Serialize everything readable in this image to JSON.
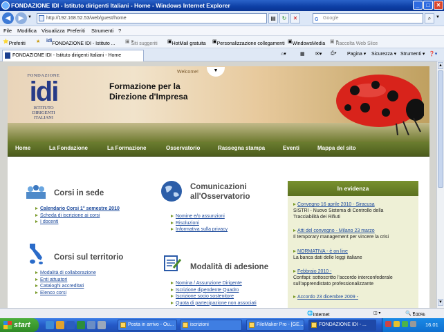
{
  "window": {
    "title": "FONDAZIONE IDI - Istituto dirigenti Italiani - Home - Windows Internet Explorer"
  },
  "address": {
    "url": "http://192.168.52.53/web/guest/home",
    "search_placeholder": "Google"
  },
  "menu": [
    "File",
    "Modifica",
    "Visualizza",
    "Preferiti",
    "Strumenti",
    "?"
  ],
  "favorites": {
    "label": "Preferiti",
    "items": [
      "FONDAZIONE IDI - Istituto ...",
      "Siti suggeriti",
      "HotMail gratuita",
      "Personalizzazione collegamenti",
      "WindowsMedia",
      "Raccolta Web Slice"
    ]
  },
  "tab": {
    "label": "FONDAZIONE IDI - Istituto dirigenti Italiani - Home"
  },
  "toolbar": {
    "page": "Pagina",
    "security": "Sicurezza",
    "tools": "Strumenti"
  },
  "banner": {
    "welcome": "Welcome!",
    "tagline_1": "Formazione per la",
    "tagline_2": "Direzione d'Impresa",
    "logo_top": "FONDAZIONE",
    "logo_idi": "idi",
    "logo_sub_1": "ISTITUTO",
    "logo_sub_2": "DIRIGENTI",
    "logo_sub_3": "ITALIANI"
  },
  "nav": [
    "Home",
    "La Fondazione",
    "La Formazione",
    "Osservatorio",
    "Rassegna stampa",
    "Eventi",
    "Mappa del sito"
  ],
  "sections": {
    "corsi_sede": {
      "title": "Corsi in sede",
      "links": [
        "Calendario Corsi 1° semestre 2010",
        "Scheda di iscrizione ai corsi",
        "I docenti"
      ]
    },
    "corsi_territorio": {
      "title": "Corsi sul territorio",
      "links": [
        "Modalità di collaborazione",
        "Enti attuatori",
        "Cataloghi accreditati",
        "Elenco corsi"
      ]
    },
    "comunicazioni": {
      "title_1": "Comunicazioni",
      "title_2": "all'Osservatorio",
      "links": [
        "Nomine e/o assunzioni",
        "Risoluzioni",
        "Informativa sulla privacy"
      ]
    },
    "adesione": {
      "title": "Modalità di adesione",
      "links": [
        "Nomina / Assunzione Dirigente",
        "Iscrizione dipendente Quadro",
        "Iscrizione socio sostenitore",
        "Quota di partecipazione non associati"
      ]
    }
  },
  "evidenza": {
    "title": "In evidenza",
    "items": [
      {
        "link": "Convegno 16 aprile 2010 - Siracusa",
        "text_1": "SISTRI - Nuovo Sistema di Controllo della",
        "text_2": "Tracciabilità dei Rifiuti"
      },
      {
        "link": "Atti del convegno - Milano 23 marzo",
        "text_1": "Il temporary management per vincere la crisi",
        "text_2": ""
      },
      {
        "link": "NORMATIVA - è on line",
        "text_1": "La banca dati delle leggi italiane",
        "text_2": ""
      },
      {
        "link": "Febbraio 2010 -",
        "text_1": "Confapi: sottoscritto l'accordo interconfederale",
        "text_2": "sull'apprendistato professionalizzante"
      },
      {
        "link": "Accordo 23 dicembre 2009 -",
        "text_1": "",
        "text_2": ""
      }
    ]
  },
  "status": {
    "zone": "Internet",
    "zoom": "100%"
  },
  "taskbar": {
    "start": "start",
    "tasks": [
      "Posta in arrivo - Ou...",
      "iscrizioni",
      "FileMaker Pro - [GE...",
      "FONDAZIONE IDI - ..."
    ],
    "clock": "16.01"
  },
  "colors": {
    "nav_green": "#5b6e22",
    "title_blue": "#0d3fa5",
    "link_blue": "#1d4a9c",
    "ladybug_red": "#d8231b"
  }
}
